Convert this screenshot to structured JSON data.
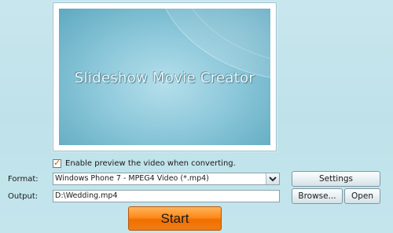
{
  "preview": {
    "title": "Slideshow Movie Creator"
  },
  "preview_option": {
    "label": "Enable preview the video when converting.",
    "checked": true
  },
  "format": {
    "label": "Format:",
    "value": "Windows Phone 7 - MPEG4 Video (*.mp4)"
  },
  "output": {
    "label": "Output:",
    "value": "D:\\Wedding.mp4"
  },
  "buttons": {
    "settings": "Settings",
    "browse": "Browse...",
    "open": "Open",
    "start": "Start"
  },
  "colors": {
    "start_button": "#ff8a1c",
    "background": "#c4e5ec"
  }
}
